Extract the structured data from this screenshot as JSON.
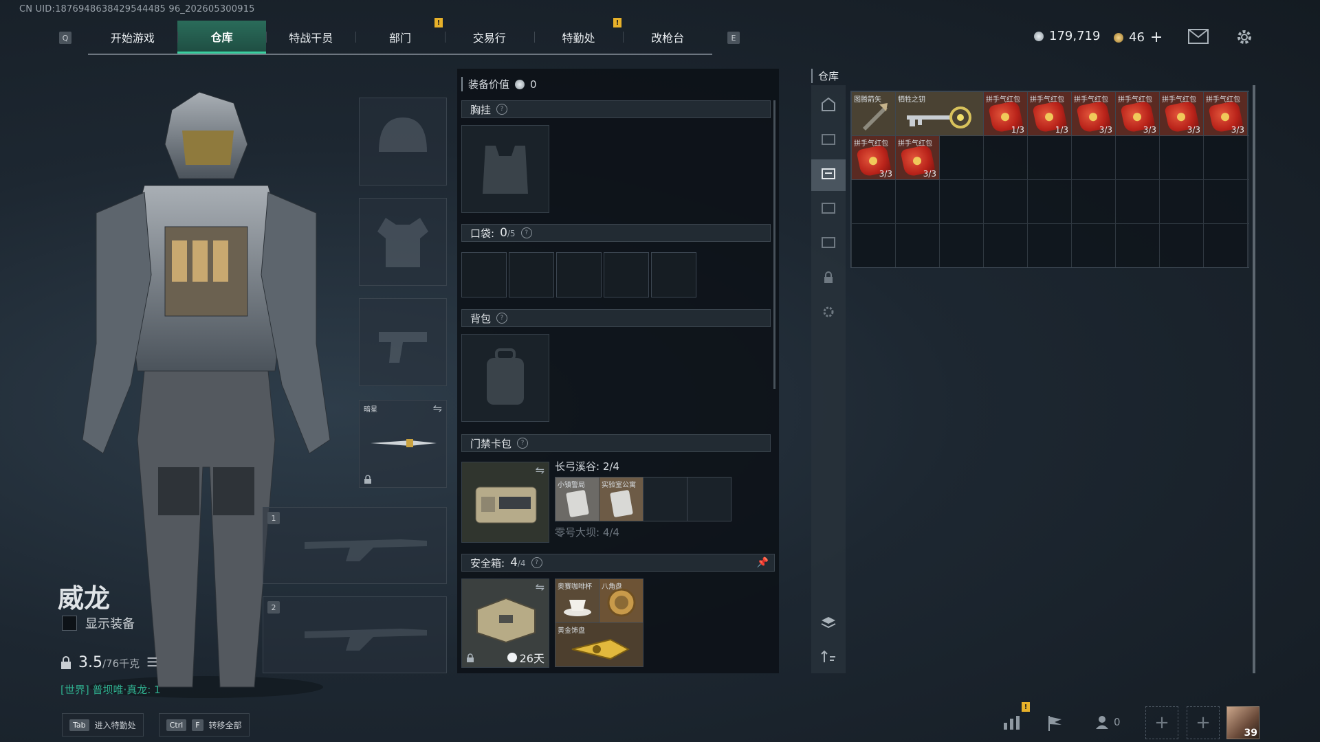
{
  "uid": "CN UID:1876948638429544485 96_202605300915",
  "nav": {
    "key_left": "Q",
    "key_right": "E",
    "tabs": [
      "开始游戏",
      "仓库",
      "特战干员",
      "部门",
      "交易行",
      "特勤处",
      "改枪台"
    ],
    "alert": "!"
  },
  "currency": {
    "silver": "179,719",
    "gold": "46",
    "plus": "+"
  },
  "character": {
    "name": "威龙",
    "show_equipment": "显示装备",
    "weight_value": "3.5",
    "weight_max": "/76千克",
    "world_line": "[世界] 普坝唯·真龙: 1"
  },
  "hints": [
    {
      "keys": [
        "Tab"
      ],
      "label": "进入特勤处"
    },
    {
      "keys": [
        "Ctrl",
        "F"
      ],
      "label": "转移全部"
    }
  ],
  "equipment": {
    "melee_label": "暗星",
    "slot1": "1",
    "slot2": "2"
  },
  "middle": {
    "value_label": "装备价值",
    "value": "0",
    "chest_rig": "胸挂",
    "pockets_label": "口袋:",
    "pockets_value": "0",
    "pockets_max": "/5",
    "backpack": "背包",
    "keycard": "门禁卡包",
    "keycard_map1": "长弓溪谷: 2/4",
    "keycard_map2": "零号大坝: 4/4",
    "keycard_items": [
      "小镇警局",
      "实验室公寓"
    ],
    "safe_label": "安全箱:",
    "safe_value": "4",
    "safe_max": "/4",
    "safe_days": "26天",
    "safe_items": [
      "奥赛咖啡杯",
      "八角盘",
      "黄金饰盘"
    ]
  },
  "warehouse": {
    "title": "仓库",
    "items": [
      {
        "label": "图腾箭矢",
        "count": ""
      },
      {
        "label": "牺牲之钥",
        "count": ""
      },
      {
        "label": "拼手气红包",
        "count": "1/3"
      },
      {
        "label": "拼手气红包",
        "count": "1/3"
      },
      {
        "label": "拼手气红包",
        "count": "3/3"
      },
      {
        "label": "拼手气红包",
        "count": "3/3"
      },
      {
        "label": "拼手气红包",
        "count": "3/3"
      },
      {
        "label": "拼手气红包",
        "count": "3/3"
      },
      {
        "label": "拼手气红包",
        "count": "3/3"
      },
      {
        "label": "拼手气红包",
        "count": "3/3"
      }
    ]
  },
  "toolbar": {
    "friends": "0",
    "level": "39",
    "alert": "!"
  },
  "colors": {
    "accent": "#39d0a0",
    "tab_active": "#1f4e43",
    "alert": "#e7b12a",
    "red_packet": "#c8301f"
  }
}
